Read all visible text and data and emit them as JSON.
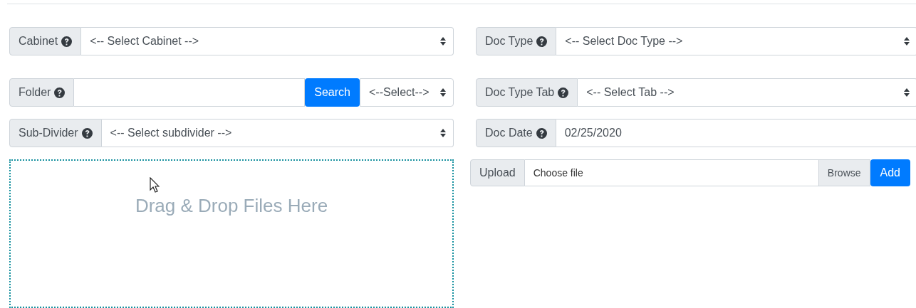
{
  "left": [
    {
      "kind": "select",
      "label": "Cabinet",
      "value": "<-- Select Cabinet -->"
    },
    {
      "kind": "search",
      "label": "Folder",
      "button": "Search",
      "select_value": "<--Select-->"
    },
    {
      "kind": "select",
      "label": "Sub-Divider",
      "value": "<-- Select subdivider -->"
    }
  ],
  "dropzone": {
    "text": "Drag & Drop Files Here"
  },
  "right": [
    {
      "kind": "select",
      "label": "Doc Type",
      "value": "<-- Select Doc Type -->"
    },
    {
      "kind": "select",
      "label": "Doc Type Tab",
      "value": "<-- Select Tab -->"
    },
    {
      "kind": "text",
      "label": "Doc Date",
      "value": "02/25/2020"
    }
  ],
  "upload": {
    "label": "Upload",
    "placeholder": "Choose file",
    "browse": "Browse",
    "button": "Add"
  }
}
